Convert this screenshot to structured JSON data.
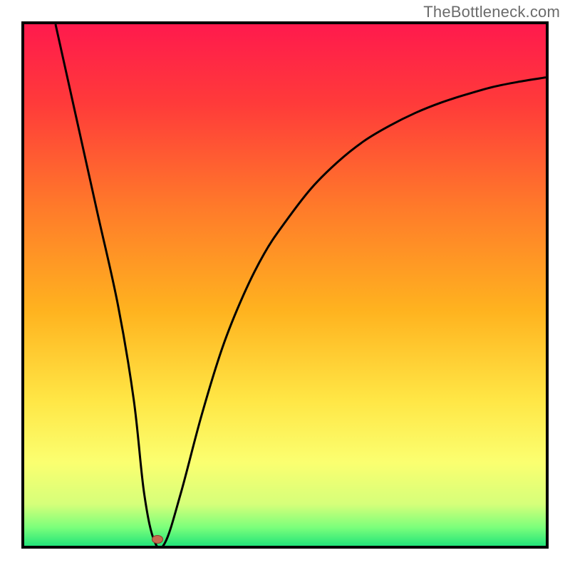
{
  "watermark": "TheBottleneck.com",
  "colors": {
    "gradient_stops": [
      {
        "offset": 0.0,
        "color": "#ff1a4d"
      },
      {
        "offset": 0.15,
        "color": "#ff3a3a"
      },
      {
        "offset": 0.35,
        "color": "#ff7a2a"
      },
      {
        "offset": 0.55,
        "color": "#ffb31f"
      },
      {
        "offset": 0.72,
        "color": "#ffe645"
      },
      {
        "offset": 0.84,
        "color": "#fbff70"
      },
      {
        "offset": 0.92,
        "color": "#d6ff7a"
      },
      {
        "offset": 0.965,
        "color": "#7bff7b"
      },
      {
        "offset": 1.0,
        "color": "#23e47a"
      }
    ],
    "curve_stroke": "#000000",
    "dot_fill": "#c66a4f",
    "dot_stroke": "#8a3f2f",
    "frame_border": "#000000"
  },
  "plot": {
    "inner_width": 732,
    "inner_height": 732
  },
  "chart_data": {
    "type": "line",
    "title": "",
    "xlabel": "",
    "ylabel": "",
    "xlim": [
      0,
      100
    ],
    "ylim": [
      0,
      100
    ],
    "grid": false,
    "legend_position": "none",
    "series": [
      {
        "name": "bottleneck-curve",
        "x": [
          6,
          10,
          14,
          18,
          21,
          23,
          25,
          27,
          30,
          34,
          38,
          42,
          46,
          50,
          55,
          60,
          65,
          70,
          75,
          80,
          85,
          90,
          95,
          100
        ],
        "y": [
          100,
          82,
          64,
          46,
          28,
          10,
          0.8,
          0.6,
          10,
          25,
          38,
          48,
          56,
          62,
          68.5,
          73.5,
          77.5,
          80.5,
          83,
          85,
          86.6,
          88,
          89,
          89.8
        ]
      }
    ],
    "marker_point": {
      "x": 25.5,
      "y": 1.2
    },
    "annotations": []
  }
}
